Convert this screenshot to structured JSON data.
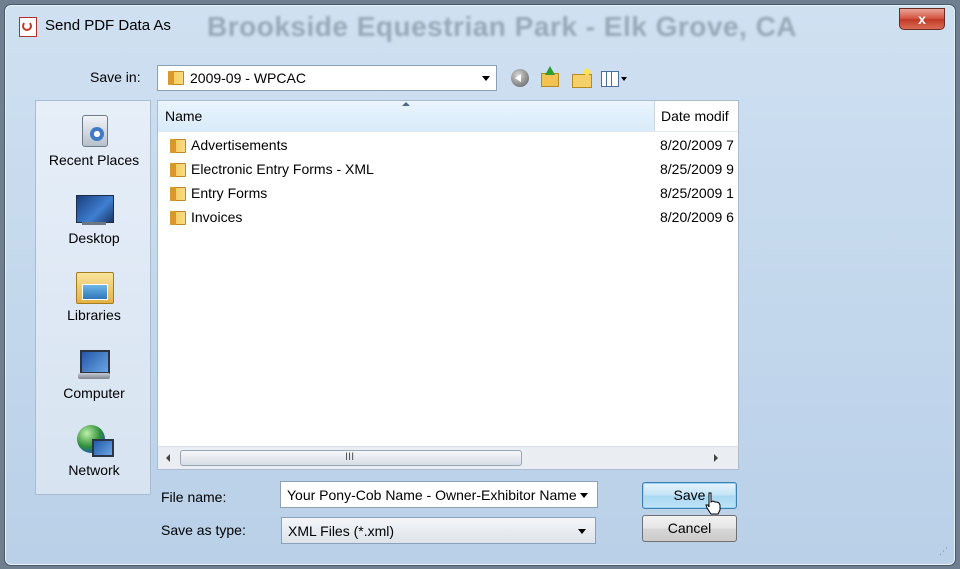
{
  "window": {
    "title": "Send PDF Data As",
    "background_title": "Brookside Equestrian Park - Elk Grove, CA",
    "close_label": "x"
  },
  "save_in": {
    "label": "Save in:",
    "value": "2009-09 - WPCAC"
  },
  "places": [
    {
      "label": "Recent Places",
      "icon": "recent-places-icon"
    },
    {
      "label": "Desktop",
      "icon": "desktop-icon"
    },
    {
      "label": "Libraries",
      "icon": "libraries-icon"
    },
    {
      "label": "Computer",
      "icon": "computer-icon"
    },
    {
      "label": "Network",
      "icon": "network-icon"
    }
  ],
  "columns": {
    "name": "Name",
    "date": "Date modif"
  },
  "files": [
    {
      "name": "Advertisements",
      "date": "8/20/2009 7"
    },
    {
      "name": "Electronic Entry Forms - XML",
      "date": "8/25/2009 9"
    },
    {
      "name": "Entry Forms",
      "date": "8/25/2009 1"
    },
    {
      "name": "Invoices",
      "date": "8/20/2009 6"
    }
  ],
  "scrollbar": {
    "grip": "III"
  },
  "file_name": {
    "label": "File name:",
    "value": "Your Pony-Cob Name - Owner-Exhibitor Name"
  },
  "save_as_type": {
    "label": "Save as type:",
    "value": "XML Files (*.xml)"
  },
  "buttons": {
    "save": "Save",
    "cancel": "Cancel"
  },
  "colors": {
    "window_frame": "#b9d0e8",
    "close_button": "#c23a26",
    "folder": "#f6cf66",
    "default_button": "#a9d8f3"
  }
}
